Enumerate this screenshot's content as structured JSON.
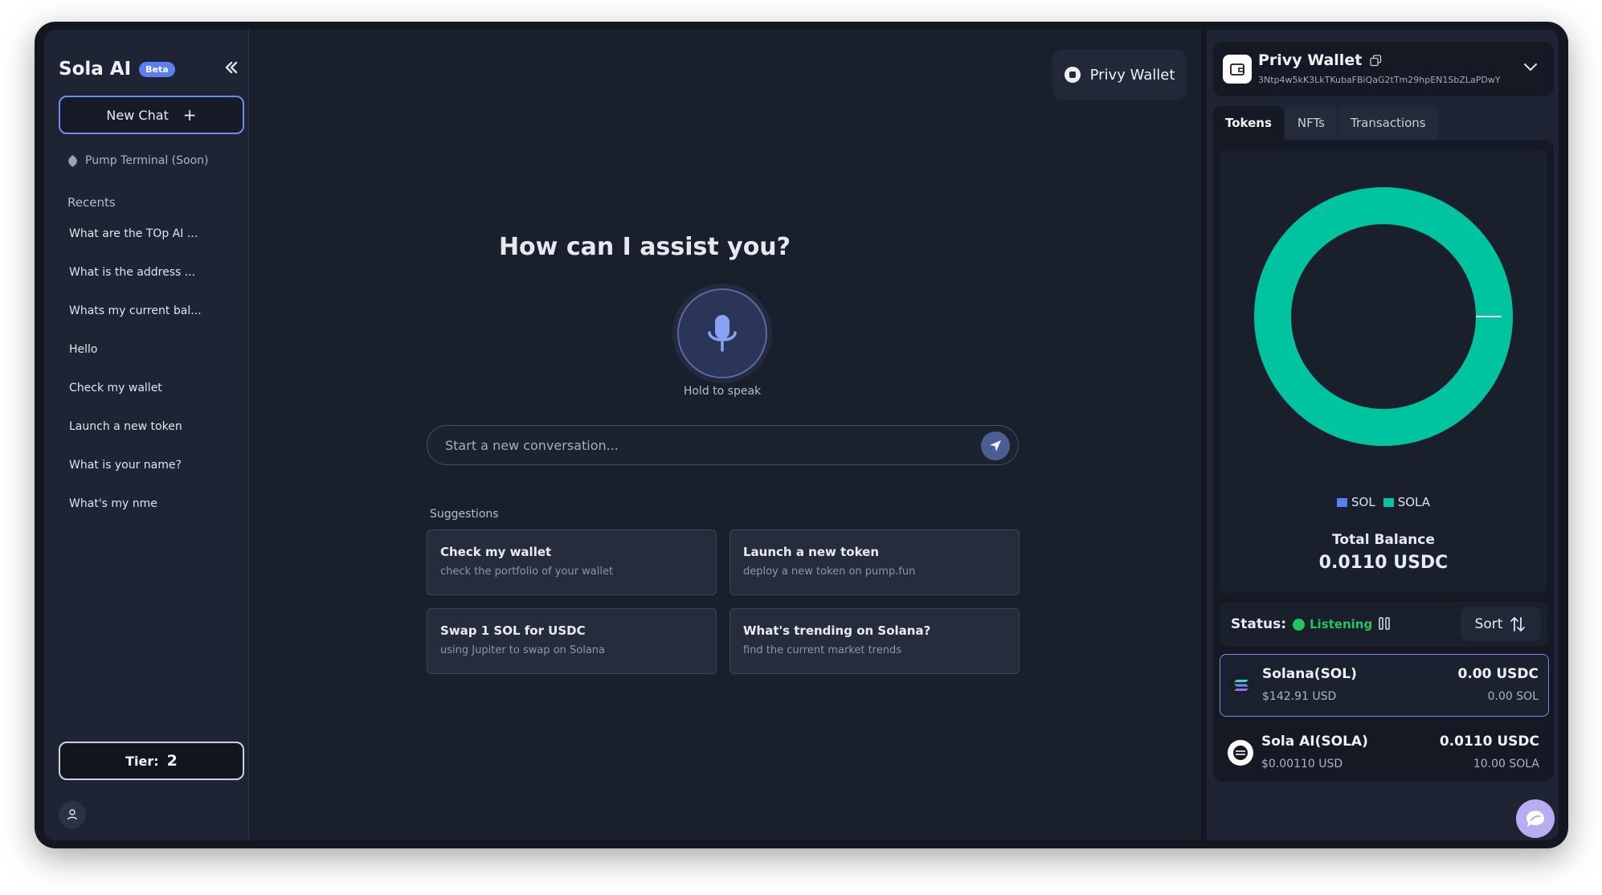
{
  "app": {
    "brand": "Sola AI",
    "beta_label": "Beta"
  },
  "sidebar": {
    "new_chat_label": "New Chat",
    "pump_terminal_label": "Pump Terminal (Soon)",
    "recents_title": "Recents",
    "recents": [
      "What are the TOp AI ...",
      "What is the address ...",
      "Whats my current bal...",
      "Hello",
      "Check my wallet",
      "Launch a new token",
      "What is your name?",
      "What's my nme"
    ],
    "tier_label": "Tier:",
    "tier_value": "2"
  },
  "main": {
    "wallet_button_label": "Privy Wallet",
    "headline": "How can I assist you?",
    "hold_to_speak": "Hold to speak",
    "input_placeholder": "Start a new conversation...",
    "suggestions_title": "Suggestions",
    "suggestions": [
      {
        "title": "Check my wallet",
        "desc": "check the portfolio of your wallet"
      },
      {
        "title": "Launch a new token",
        "desc": "deploy a new token on pump.fun"
      },
      {
        "title": "Swap 1 SOL for USDC",
        "desc": "using Jupiter to swap on Solana"
      },
      {
        "title": "What's trending on Solana?",
        "desc": "find the current market trends"
      }
    ]
  },
  "wallet": {
    "title": "Privy Wallet",
    "address": "3Ntp4w5kK3LkTKubaFBiQaG2tTm29hpEN1SbZLaPDwY",
    "tabs": [
      "Tokens",
      "NFTs",
      "Transactions"
    ],
    "legend": [
      {
        "name": "SOL",
        "color": "#5b7ef0"
      },
      {
        "name": "SOLA",
        "color": "#00c49f"
      }
    ],
    "total_label": "Total Balance",
    "total_value": "0.0110 USDC",
    "status_label": "Status:",
    "status_value": "Listening",
    "sort_label": "Sort",
    "tokens": [
      {
        "name": "Solana(SOL)",
        "usd_price": "$142.91 USD",
        "value": "0.00 USDC",
        "amount": "0.00 SOL"
      },
      {
        "name": "Sola AI(SOLA)",
        "usd_price": "$0.00110 USD",
        "value": "0.0110 USDC",
        "amount": "10.00 SOLA"
      }
    ]
  },
  "colors": {
    "accent": "#6f8cf3",
    "donut": "#00c49f",
    "listening": "#22c55e"
  },
  "icons": {
    "collapse": "chevrons-left-icon",
    "plus": "plus-icon",
    "tag": "tag-icon",
    "user": "user-icon",
    "wallet": "wallet-icon",
    "mic": "microphone-icon",
    "send": "send-icon",
    "copy": "copy-icon",
    "chevron": "chevron-down-icon",
    "pause": "pause-icon",
    "sort": "sort-icon",
    "chat": "chat-bubble-icon"
  }
}
